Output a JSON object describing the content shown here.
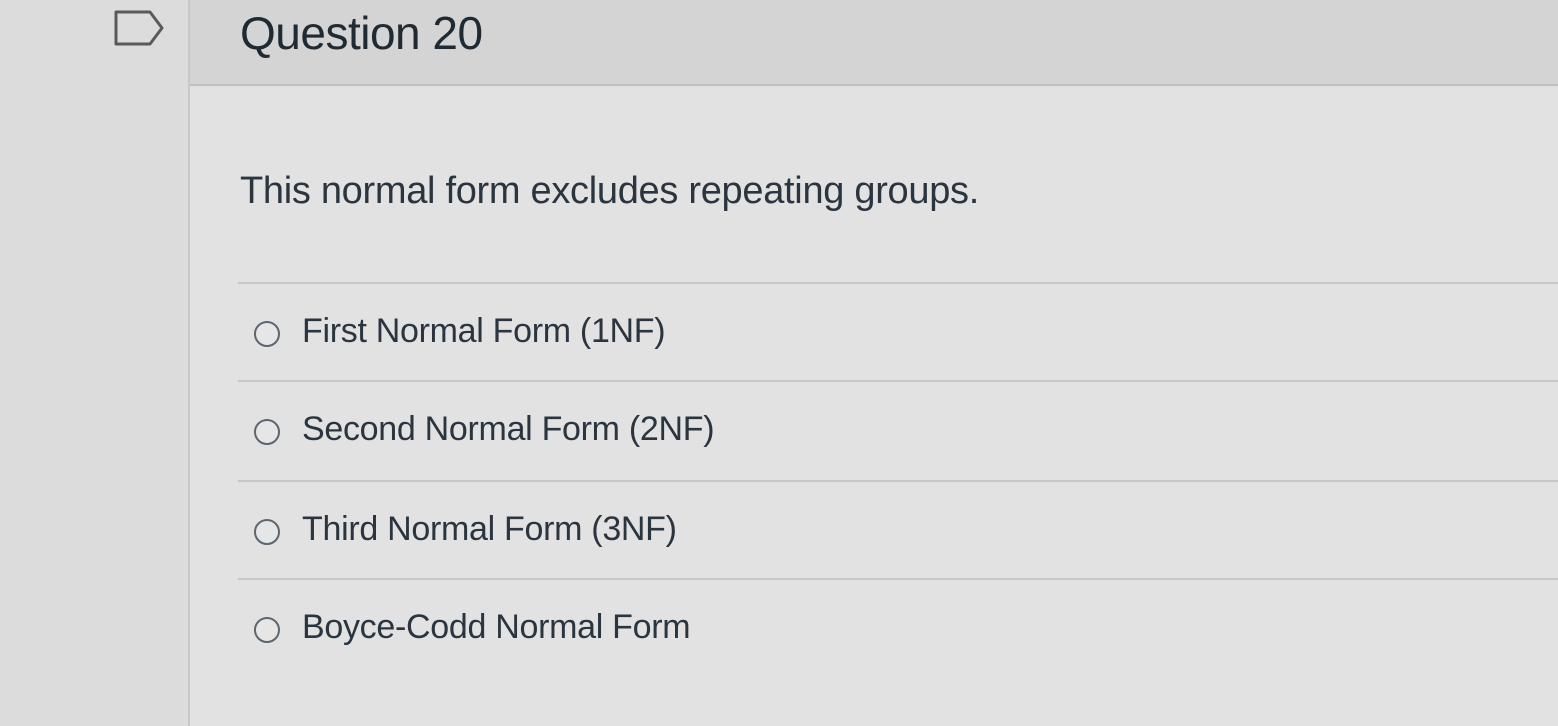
{
  "question": {
    "title": "Question 20",
    "text": "This normal form excludes repeating groups."
  },
  "answers": [
    {
      "label": "First Normal Form (1NF)",
      "selected": false
    },
    {
      "label": "Second Normal Form (2NF)",
      "selected": false
    },
    {
      "label": "Third Normal Form (3NF)",
      "selected": false
    },
    {
      "label": "Boyce-Codd Normal Form",
      "selected": false
    }
  ],
  "icons": {
    "flag": "flag-question-icon",
    "radio": "radio-unselected-icon"
  }
}
